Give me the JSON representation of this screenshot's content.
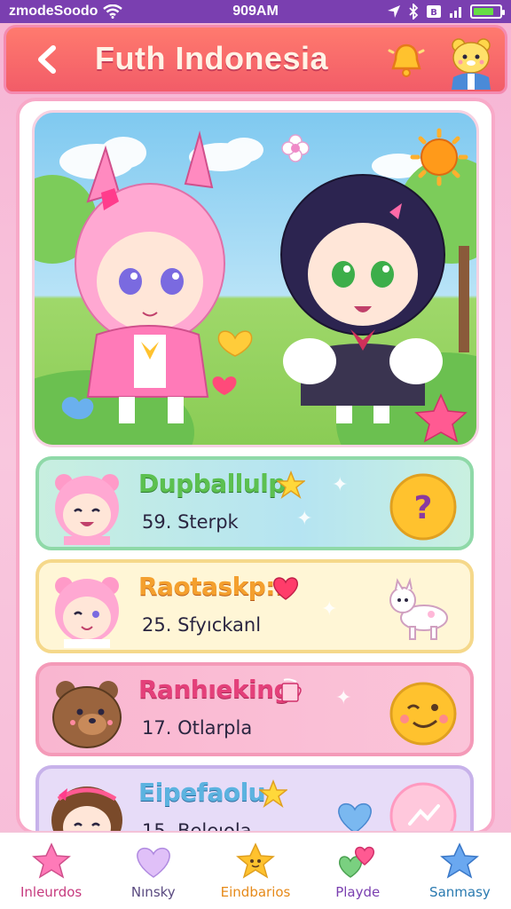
{
  "status_bar": {
    "carrier": "zmodeSoodo",
    "time": "909AM",
    "battery_level": 0.8
  },
  "header": {
    "title": "Futh Indonesia",
    "back_icon": "chevron-left-icon",
    "bell_icon": "bell-icon",
    "avatar_icon": "bear-avatar-icon"
  },
  "hero": {
    "characters": [
      "pink-bunny-girl",
      "dark-haired-girl"
    ]
  },
  "cards": [
    {
      "name": "Dupballulp",
      "sub": "59. Sterpk",
      "badge_icon": "star-icon",
      "action_icon": "question-icon",
      "accent": "#5cc050"
    },
    {
      "name": "Raotaskp:.",
      "sub": "25. Sfyıckanl",
      "badge_icon": "heart-icon",
      "action_icon": "llama-icon",
      "accent": "#f4a02e"
    },
    {
      "name": "Ranhıeking",
      "sub": "17. Otlarpla",
      "badge_icon": "cup-icon",
      "action_icon": "smiley-icon",
      "accent": "#e4407a"
    },
    {
      "name": "Eipefaolu",
      "sub": "15. Beleıola",
      "badge_icon": "star-icon",
      "action_icon": "chart-icon",
      "accent": "#5cb3e0"
    }
  ],
  "nav": [
    {
      "label": "Inleurdos",
      "icon": "star-icon"
    },
    {
      "label": "Nınsky",
      "icon": "heart-icon"
    },
    {
      "label": "Eindbarios",
      "icon": "star-face-icon"
    },
    {
      "label": "Playde",
      "icon": "hearts-icon"
    },
    {
      "label": "Sanmasy",
      "icon": "star-icon"
    }
  ]
}
